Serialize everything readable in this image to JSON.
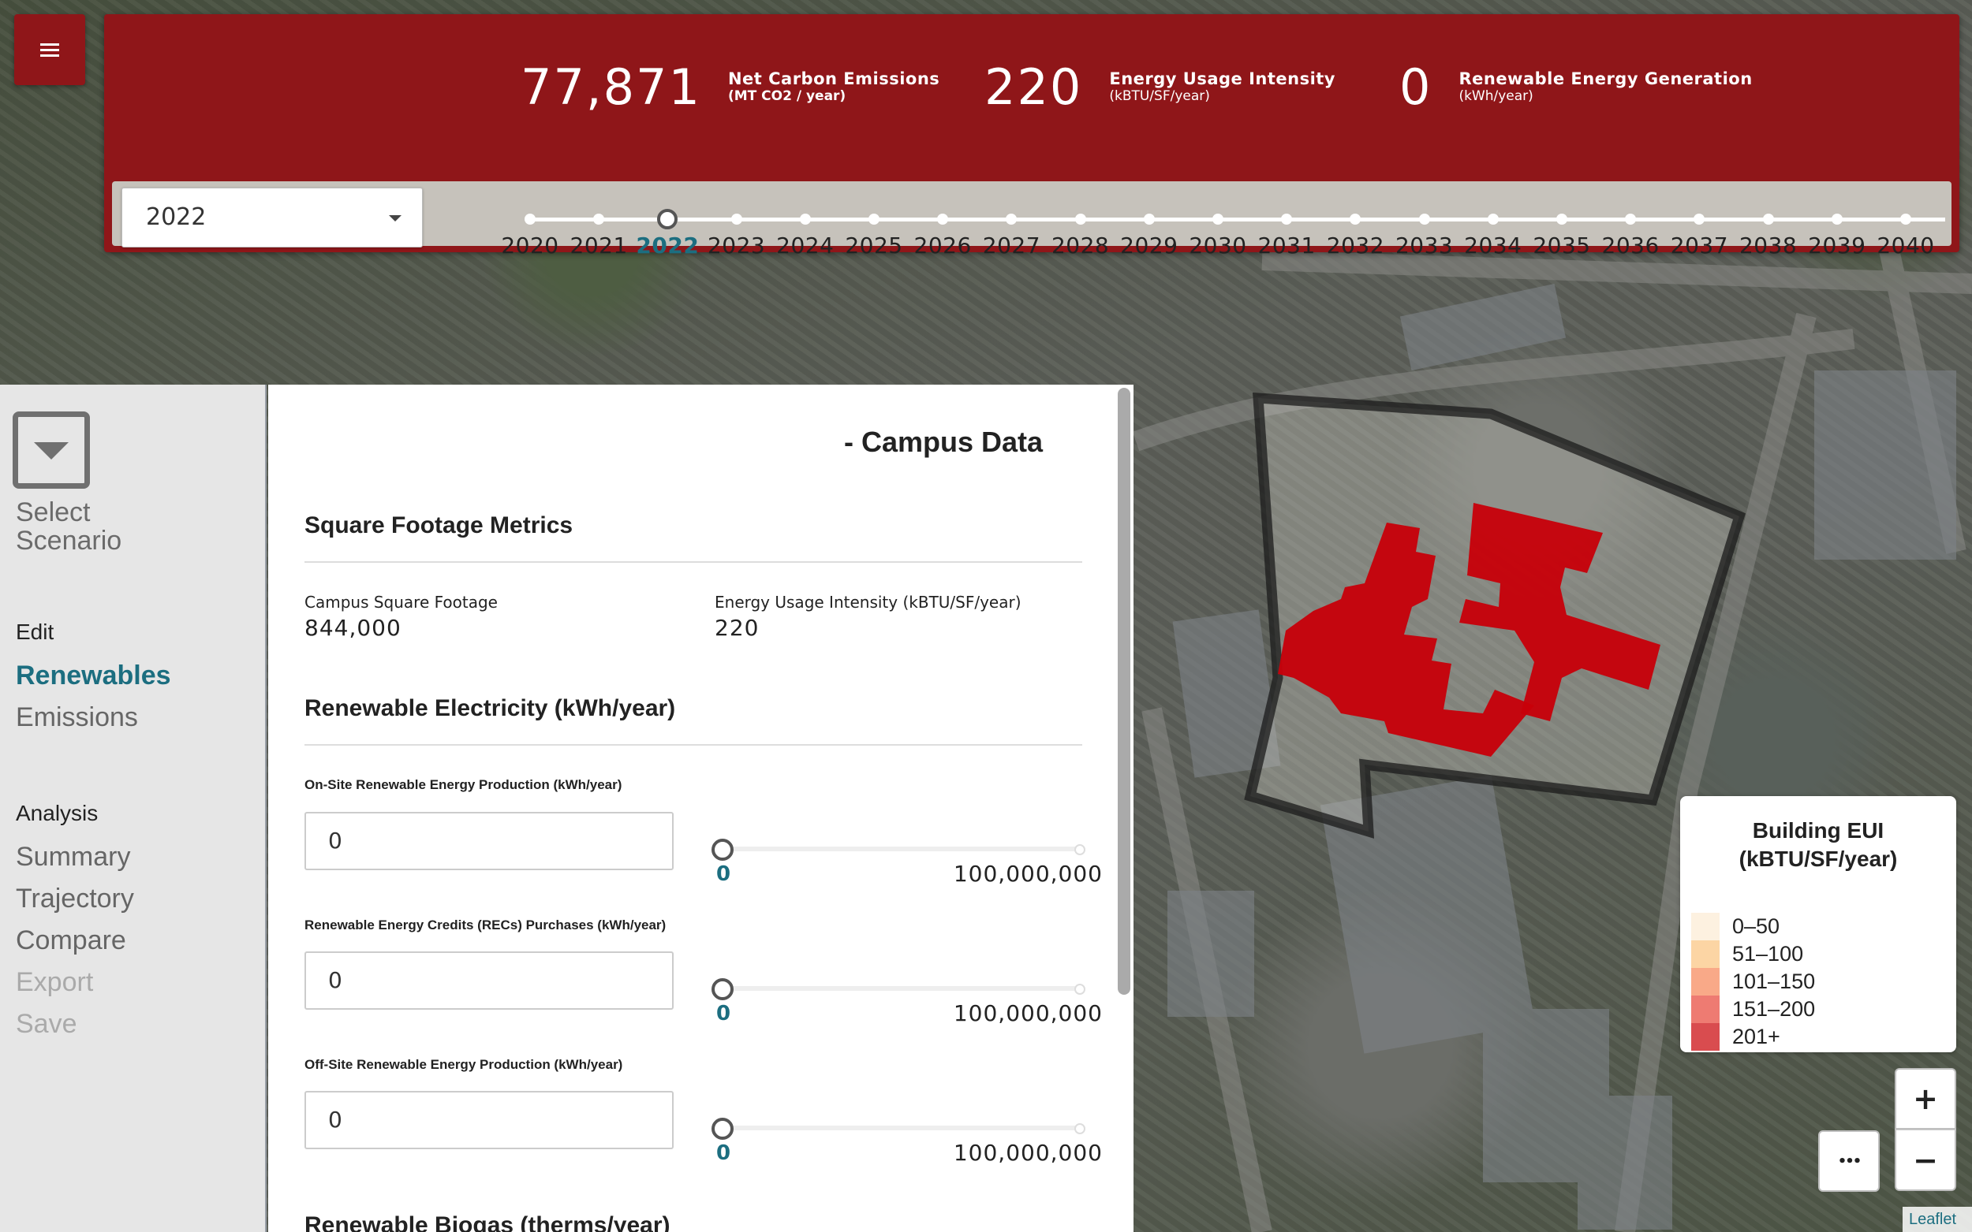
{
  "metrics": [
    {
      "value": "77,871",
      "label": "Net Carbon Emissions",
      "unit": "(MT CO2 / year)"
    },
    {
      "value": "220",
      "label": "Energy Usage Intensity",
      "unit": "(kBTU/SF/year)"
    },
    {
      "value": "0",
      "label": "Renewable Energy Generation",
      "unit": "(kWh/year)"
    }
  ],
  "year_select": {
    "value": "2022"
  },
  "timeline": {
    "years": [
      "2020",
      "2021",
      "2022",
      "2023",
      "2024",
      "2025",
      "2026",
      "2027",
      "2028",
      "2029",
      "2030",
      "2031",
      "2032",
      "2033",
      "2034",
      "2035",
      "2036",
      "2037",
      "2038",
      "2039",
      "2040"
    ],
    "selected": "2022"
  },
  "sidebar": {
    "scenario_line1": "Select",
    "scenario_line2": "Scenario",
    "edit_heading": "Edit",
    "edit_items": [
      "Renewables",
      "Emissions"
    ],
    "analysis_heading": "Analysis",
    "analysis_items": [
      "Summary",
      "Trajectory",
      "Compare",
      "Export",
      "Save"
    ]
  },
  "panel": {
    "title": "- Campus Data",
    "section1": "Square Footage Metrics",
    "sqft_label": "Campus Square Footage",
    "sqft_value": "844,000",
    "eui_label": "Energy Usage Intensity (kBTU/SF/year)",
    "eui_value": "220",
    "section2": "Renewable Electricity (kWh/year)",
    "inputs": [
      {
        "label": "On-Site Renewable Energy Production (kWh/year)",
        "value": "0",
        "min": "0",
        "max": "100,000,000"
      },
      {
        "label": "Renewable Energy Credits (RECs) Purchases (kWh/year)",
        "value": "0",
        "min": "0",
        "max": "100,000,000"
      },
      {
        "label": "Off-Site Renewable Energy Production (kWh/year)",
        "value": "0",
        "min": "0",
        "max": "100,000,000"
      }
    ],
    "section3": "Renewable Biogas (therms/year)"
  },
  "legend": {
    "title_line1": "Building EUI",
    "title_line2": "(kBTU/SF/year)",
    "items": [
      {
        "label": "0–50",
        "color": "#fdf1e0"
      },
      {
        "label": "51–100",
        "color": "#fcd5a4"
      },
      {
        "label": "101–150",
        "color": "#f9a988"
      },
      {
        "label": "151–200",
        "color": "#ee7b72"
      },
      {
        "label": "201+",
        "color": "#d94c4f"
      }
    ]
  },
  "map_controls": {
    "zoom_in": "+",
    "zoom_out": "−",
    "more": "•••",
    "attribution": "Leaflet"
  },
  "colors": {
    "brand": "#8f1619",
    "accent": "#1c6e80",
    "building": "#c8000a"
  }
}
